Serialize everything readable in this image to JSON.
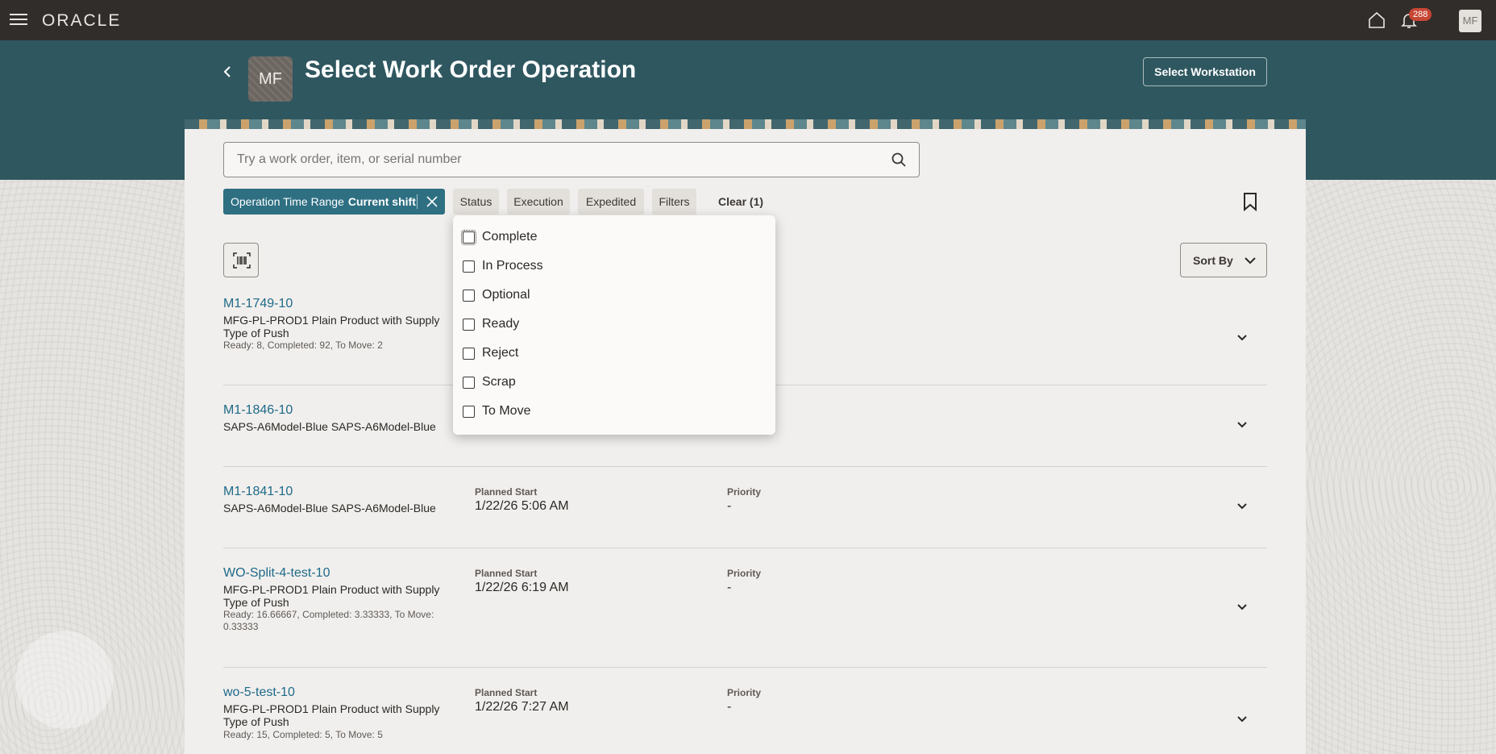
{
  "topbar": {
    "logo": "ORACLE",
    "notification_count": "288",
    "user_initials": "MF"
  },
  "header": {
    "page_avatar": "MF",
    "title": "Select Work Order Operation",
    "select_workstation": "Select Workstation"
  },
  "search": {
    "placeholder": "Try a work order, item, or serial number"
  },
  "filters": {
    "active_chip_label": "Operation Time Range",
    "active_chip_value": "Current shift",
    "status": "Status",
    "execution": "Execution",
    "expedited": "Expedited",
    "filters": "Filters",
    "clear": "Clear (1)"
  },
  "sort": {
    "label": "Sort By"
  },
  "status_options": [
    "Complete",
    "In Process",
    "Optional",
    "Ready",
    "Reject",
    "Scrap",
    "To Move"
  ],
  "work_orders": [
    {
      "number": "M1-1749-10",
      "description": "MFG-PL-PROD1 Plain Product with Supply Type of Push",
      "quantities": "Ready: 8, Completed: 92, To Move: 2",
      "planned_start_label": "",
      "planned_start": "",
      "priority_label": "",
      "priority": ""
    },
    {
      "number": "M1-1846-10",
      "description": "SAPS-A6Model-Blue SAPS-A6Model-Blue",
      "quantities": "",
      "planned_start_label": "",
      "planned_start": "",
      "priority_label": "",
      "priority": ""
    },
    {
      "number": "M1-1841-10",
      "description": "SAPS-A6Model-Blue SAPS-A6Model-Blue",
      "quantities": "",
      "planned_start_label": "Planned Start",
      "planned_start": "1/22/26 5:06 AM",
      "priority_label": "Priority",
      "priority": "-"
    },
    {
      "number": "WO-Split-4-test-10",
      "description": "MFG-PL-PROD1 Plain Product with Supply Type of Push",
      "quantities": "Ready: 16.66667, Completed: 3.33333, To Move: 0.33333",
      "planned_start_label": "Planned Start",
      "planned_start": "1/22/26 6:19 AM",
      "priority_label": "Priority",
      "priority": "-"
    },
    {
      "number": "wo-5-test-10",
      "description": "MFG-PL-PROD1 Plain Product with Supply Type of Push",
      "quantities": "Ready: 15, Completed: 5, To Move: 5",
      "planned_start_label": "Planned Start",
      "planned_start": "1/22/26 7:27 AM",
      "priority_label": "Priority",
      "priority": "-"
    }
  ]
}
